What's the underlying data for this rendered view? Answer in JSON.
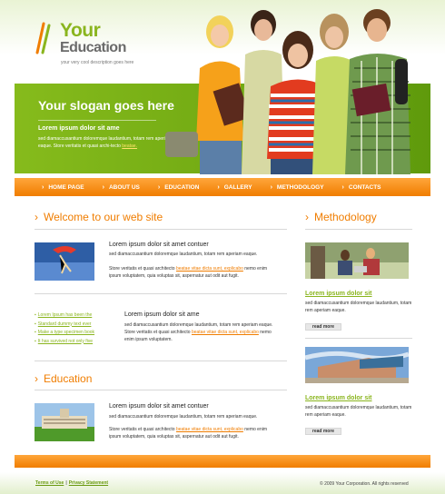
{
  "header": {
    "logo_line1": "Your",
    "logo_line2": "Education",
    "tagline": "your very cool description goes here"
  },
  "banner": {
    "slogan": "Your slogan goes here",
    "subheading": "Lorem ipsum dolor sit ame",
    "text": "sed diamaccusantium doloremque laudantium, totam rem aperiam eaque. Store veritatis et quasi archi-tecto",
    "link": "beatae."
  },
  "nav": {
    "items": [
      "HOME PAGE",
      "ABOUT US",
      "EDUCATION",
      "GALLERY",
      "METHODOLOGY",
      "CONTACTS"
    ]
  },
  "main": {
    "welcome_title": "Welcome to our web site",
    "block1": {
      "title": "Lorem ipsum dolor sit amet contuer",
      "line1": "sed diamaccusantium doloremque laudantium, totam rem aperiam eaque.",
      "line2_pre": "Store veritatis et quasi architecto ",
      "line2_link": "beatae vitae dicta sunt, explicabo",
      "line2_post": " nemo enim ipsum voluptatem, quia voluptas sit, aspernatur aut odit aut fugit."
    },
    "bullets": [
      "Lorem Ipsum has been the",
      "Standard dummy text ever",
      "Make a type specimen book",
      "It has survived not only five"
    ],
    "block2": {
      "title": "Lorem ipsum dolor sit ame",
      "line1": "sed diamaccusantium doloremque laudantium, totam rem aperiam eaque. Store veritatis et quasi architecto ",
      "line1_link": "beatae vitae dicta sunt, explicabo",
      "line1_post": " nemo enim ipsum voluptatem."
    },
    "education_title": "Education",
    "block3": {
      "title": "Lorem ipsum dolor sit amet contuer",
      "line1": "sed diamaccusantium doloremque laudantium, totam rem aperiam eaque.",
      "line2_pre": "Store veritatis et quasi architecto ",
      "line2_link": "beatae vitae dicta sunt, explicabo",
      "line2_post": " nemo enim ipsum voluptatem, quia voluptas sit, aspernatur aut odit aut fugit."
    }
  },
  "sidebar": {
    "title": "Methodology",
    "item1": {
      "link": "Lorem ipsum dolor sit",
      "text": "sed diamaccusantium doloremque laudantium, totam rem aperiam eaque.",
      "read_more": "read more"
    },
    "item2": {
      "link": "Lorem ipsum dolor sit",
      "text": "sed diamaccusantium doloremque laudantium, totam rem aperiam eaque.",
      "read_more": "read more"
    }
  },
  "footer": {
    "terms": "Terms of Use",
    "separator": "|",
    "privacy": "Privacy Statement",
    "copyright": "© 2009 Your Corporation. All rights reserved"
  },
  "colors": {
    "accent_orange": "#f07d00",
    "accent_green": "#8ab51e"
  }
}
